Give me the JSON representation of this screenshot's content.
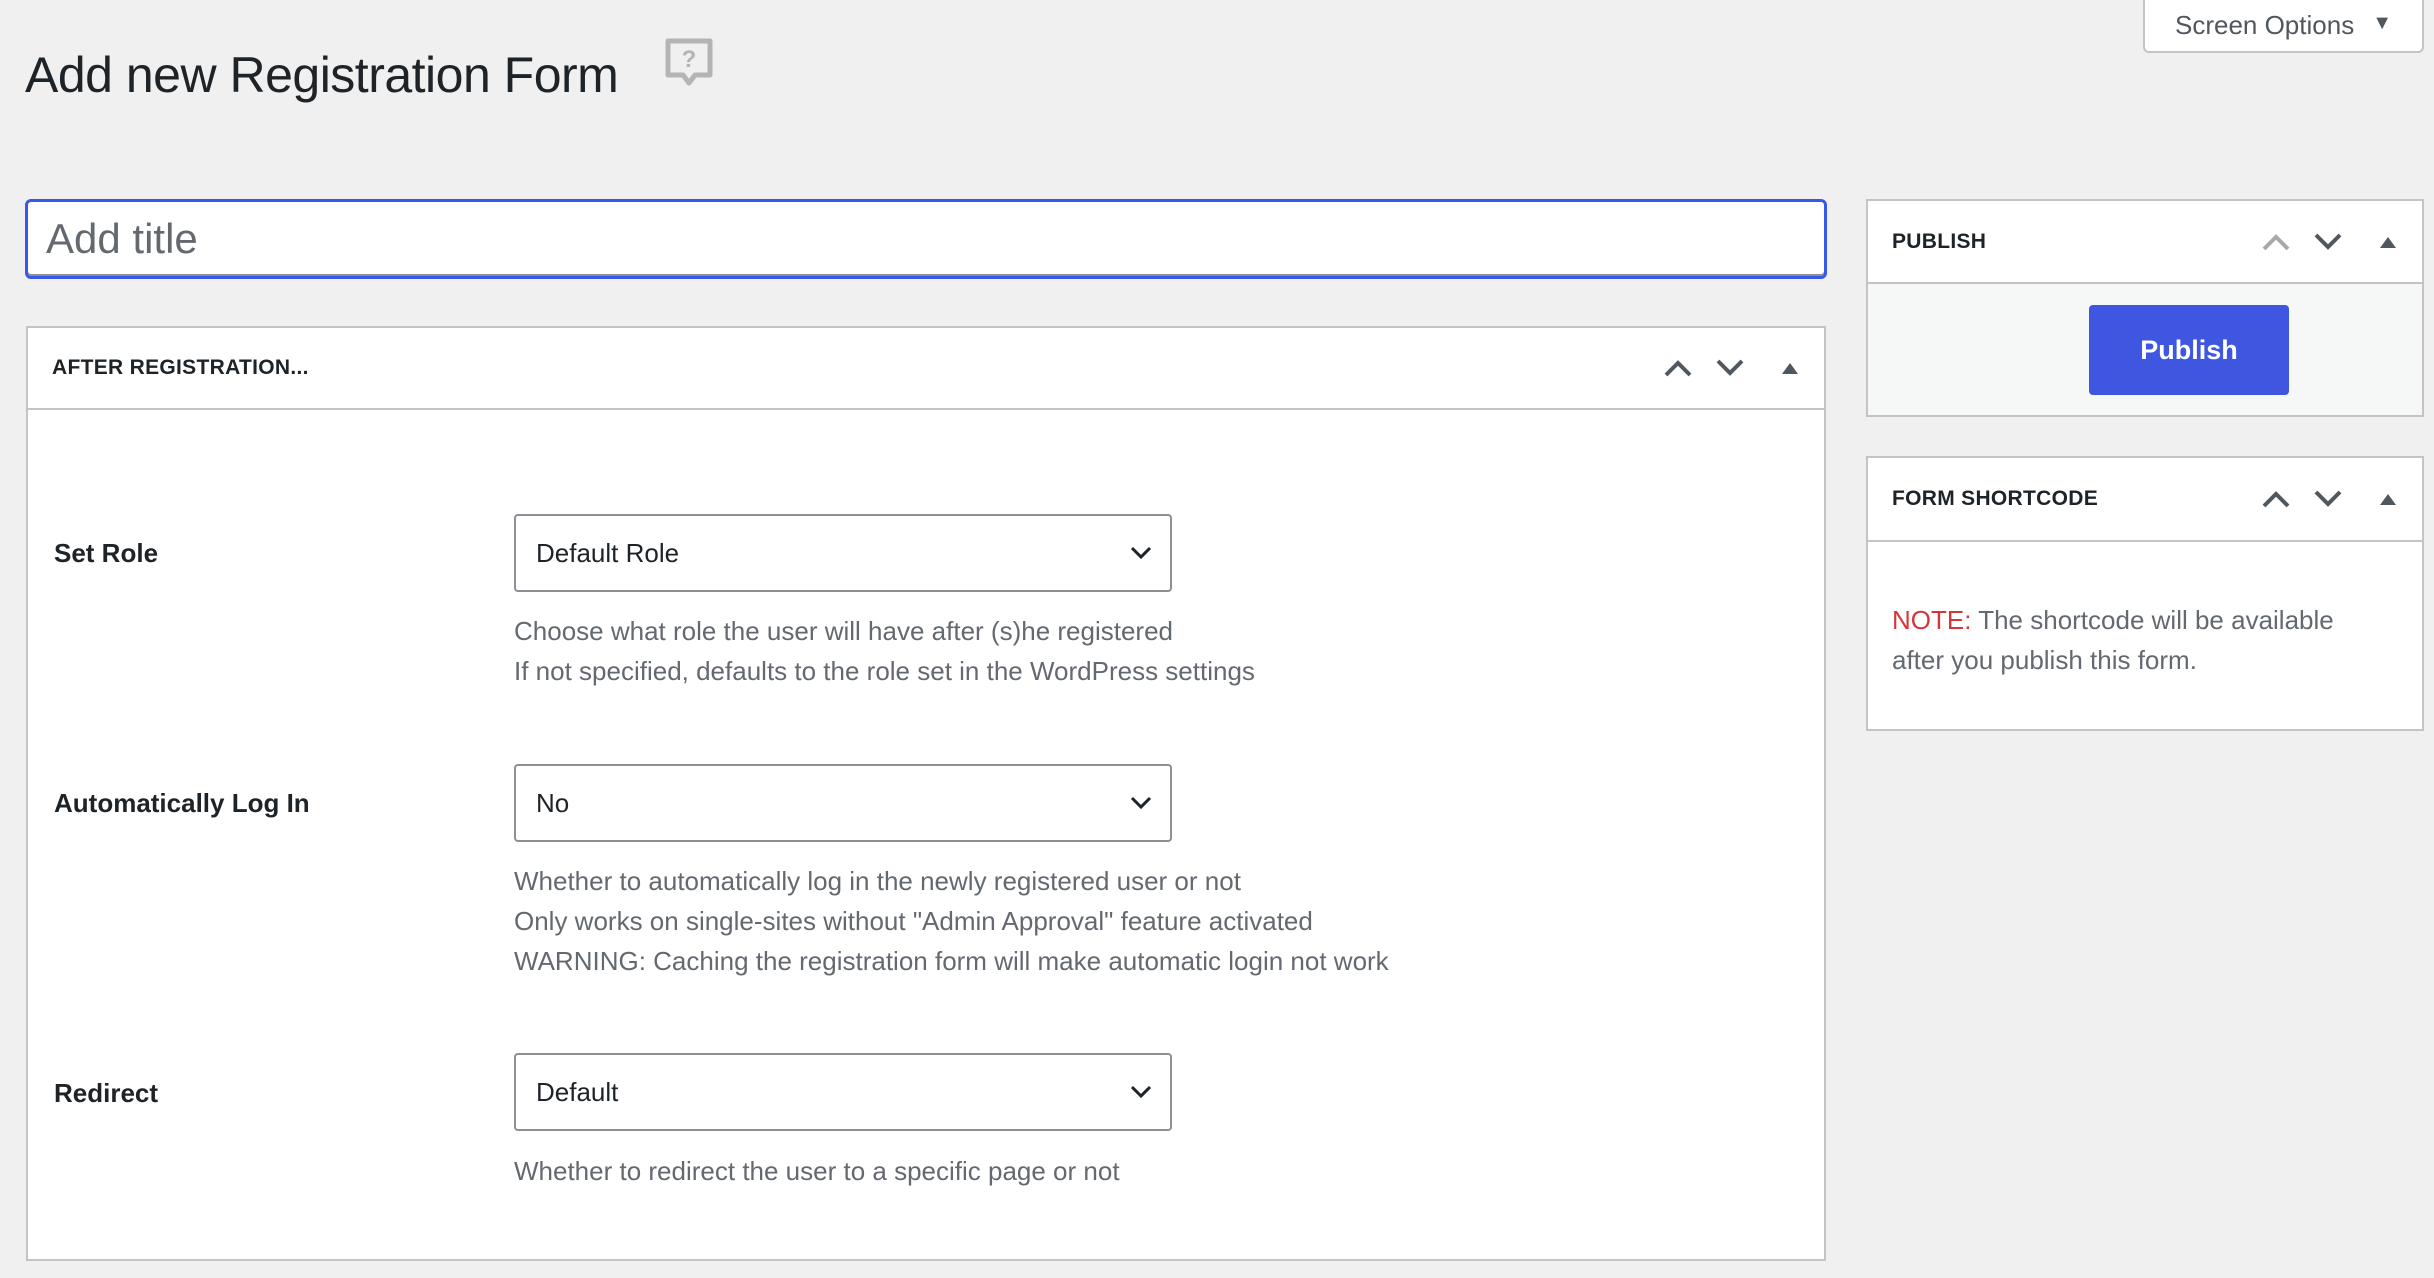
{
  "page": {
    "title": "Add new Registration Form",
    "help_icon": "help-question-icon",
    "screen_options_label": "Screen Options",
    "screen_options_icon": "triangle-down-icon"
  },
  "title_input": {
    "value": "",
    "placeholder": "Add title"
  },
  "after_registration": {
    "title": "AFTER REGISTRATION...",
    "controls": [
      "move-up-icon",
      "move-down-icon",
      "toggle-panel-icon"
    ],
    "fields": [
      {
        "label": "Set Role",
        "selected": "Default Role",
        "help": [
          "Choose what role the user will have after (s)he registered",
          "If not specified, defaults to the role set in the WordPress settings"
        ]
      },
      {
        "label": "Automatically Log In",
        "selected": "No",
        "help": [
          "Whether to automatically log in the newly registered user or not",
          "Only works on single-sites without \"Admin Approval\" feature activated",
          "WARNING: Caching the registration form will make automatic login not work"
        ]
      },
      {
        "label": "Redirect",
        "selected": "Default",
        "help": [
          "Whether to redirect the user to a specific page or not"
        ]
      }
    ]
  },
  "publish_box": {
    "title": "PUBLISH",
    "button_label": "Publish"
  },
  "shortcode_box": {
    "title": "FORM SHORTCODE",
    "note_label": "NOTE:",
    "note_text": " The shortcode will be available after you publish this form."
  },
  "colors": {
    "accent": "#3f57e0",
    "focus_border": "#3858e9",
    "note_red": "#d63638",
    "background": "#f0f0f1"
  }
}
